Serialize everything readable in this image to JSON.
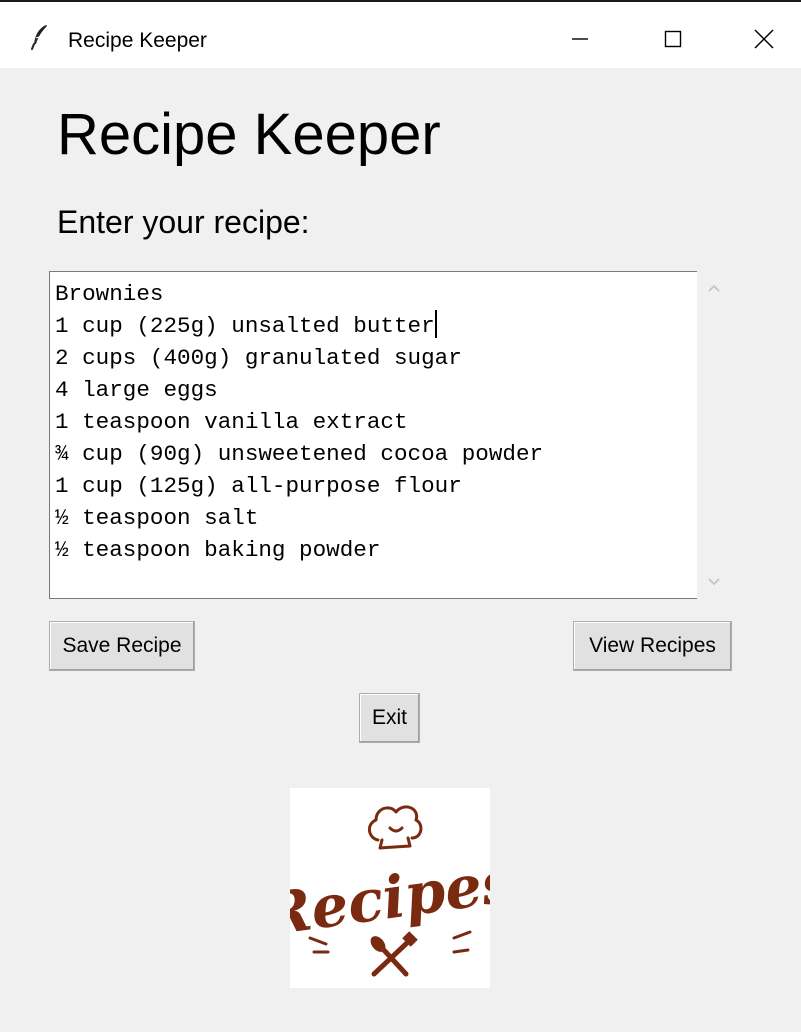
{
  "window": {
    "title": "Recipe Keeper",
    "icon": "feather-icon",
    "controls": {
      "minimize": "minimize-icon",
      "maximize": "maximize-icon",
      "close": "close-icon"
    }
  },
  "main": {
    "heading": "Recipe Keeper",
    "prompt": "Enter your recipe:",
    "recipe_lines": [
      "Brownies",
      "1 cup (225g) unsalted butter",
      "2 cups (400g) granulated sugar",
      "4 large eggs",
      "1 teaspoon vanilla extract",
      "¾ cup (90g) unsweetened cocoa powder",
      "1 cup (125g) all-purpose flour",
      "½ teaspoon salt",
      "½ teaspoon baking powder"
    ],
    "caret_line_index": 1
  },
  "buttons": {
    "save": "Save Recipe",
    "view": "View Recipes",
    "exit": "Exit"
  },
  "logo": {
    "text": "Recipes",
    "color": "#7a2a10"
  }
}
